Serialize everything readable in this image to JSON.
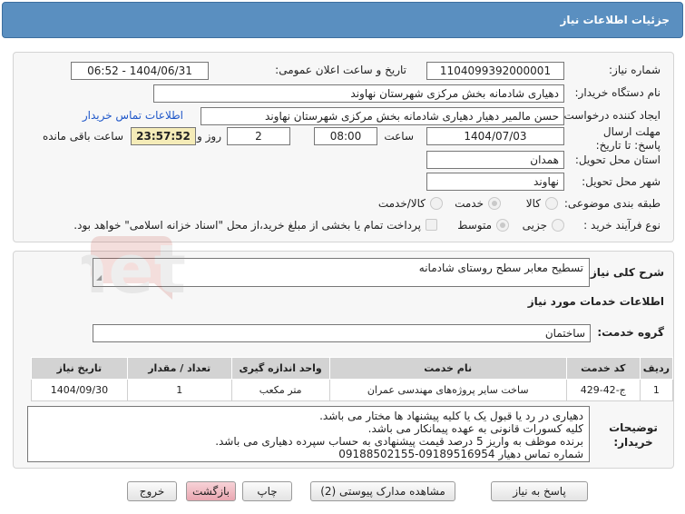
{
  "header": {
    "title": "جزئیات اطلاعات نیاز"
  },
  "need_number": {
    "label": "شماره نیاز:",
    "value": "1104099392000001"
  },
  "announce_datetime": {
    "label": "تاریخ و ساعت اعلان عمومی:",
    "value": "1404/06/31 - 06:52"
  },
  "buyer_org": {
    "label": "نام دستگاه خریدار:",
    "value": "دهیاری شادمانه بخش مرکزی شهرستان نهاوند"
  },
  "requester": {
    "label": "ایجاد کننده درخواست:",
    "value": "حسن مالمیر دهیار دهیاری شادمانه بخش مرکزی شهرستان نهاوند",
    "contact_link": "اطلاعات تماس خریدار"
  },
  "deadline": {
    "label": "مهلت ارسال پاسخ: تا تاریخ:",
    "date": "1404/07/03",
    "time_label": "ساعت",
    "time": "08:00",
    "days": "2",
    "days_label": "روز و",
    "remaining": "23:57:52",
    "remaining_label": "ساعت باقی مانده"
  },
  "province": {
    "label": "استان محل تحویل:",
    "value": "همدان"
  },
  "city": {
    "label": "شهر محل تحویل:",
    "value": "نهاوند"
  },
  "category": {
    "label": "طبقه بندی موضوعی:",
    "options": [
      "کالا",
      "خدمت",
      "کالا/خدمت"
    ],
    "selected": "خدمت"
  },
  "purchase_type": {
    "label": "نوع فرآیند خرید :",
    "options": [
      "جزیی",
      "متوسط"
    ],
    "selected": "متوسط",
    "payment_note": "پرداخت تمام یا بخشی از مبلغ خرید،از محل \"اسناد خزانه اسلامی\" خواهد بود."
  },
  "need_summary": {
    "label": "شرح کلی نیاز:",
    "value": "تسطیح معابر سطح روستای شادمانه"
  },
  "services_info": {
    "title": "اطلاعات خدمات مورد نیاز"
  },
  "service_group": {
    "label": "گروه خدمت:",
    "value": "ساختمان"
  },
  "services_table": {
    "headers": [
      "ردیف",
      "کد خدمت",
      "نام خدمت",
      "واحد اندازه گیری",
      "تعداد / مقدار",
      "تاریخ نیاز"
    ],
    "rows": [
      [
        "1",
        "ج-42-429",
        "ساخت سایر پروژه‌های مهندسی عمران",
        "متر مکعب",
        "1",
        "1404/09/30"
      ]
    ]
  },
  "buyer_notes": {
    "label": "توضیحات خریدار:",
    "lines": [
      "دهیاری در رد یا قبول یک یا کلیه پیشنهاد ها مختار می باشد.",
      "کلیه کسورات قانونی به عهده پیمانکار می باشد.",
      "برنده موظف به واریز 5 درصد قیمت پیشنهادی به حساب سپرده دهیاری می باشد.",
      "شماره تماس دهیار 09189516954-09188502155"
    ]
  },
  "buttons": {
    "reply": "پاسخ به نیاز",
    "attachments": "مشاهده مدارک پیوستی (2)",
    "print": "چاپ",
    "back": "بازگشت",
    "exit": "خروج"
  },
  "watermark": {
    "text": "AriaTender.net"
  },
  "colors": {
    "header": "#5a8fc0",
    "timer_bg": "#f5ecb8",
    "back_button": "#e9a7b1",
    "link": "#1f57c9"
  }
}
